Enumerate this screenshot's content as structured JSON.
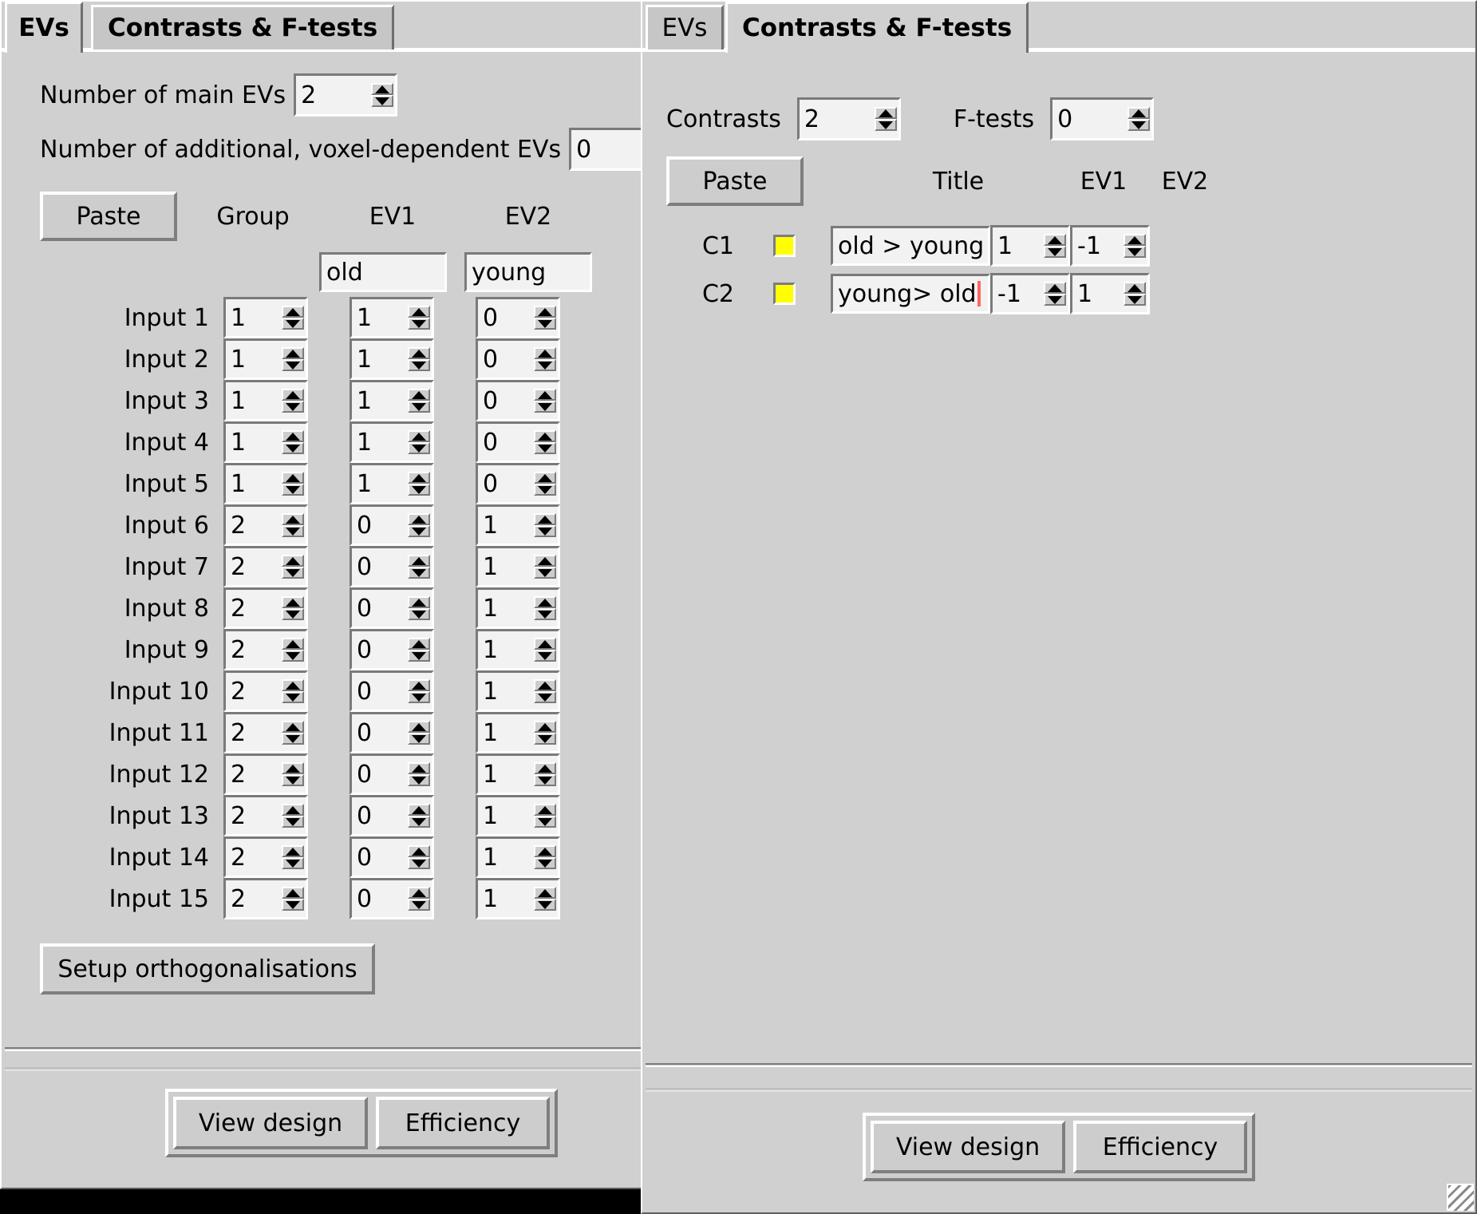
{
  "app": {
    "accent_yellow": "#ffff00",
    "bg": "#d0d0d0",
    "field_bg": "#f2f2f2",
    "caret_color": "#ff6666"
  },
  "evs_window": {
    "tabs": [
      {
        "id": "evs",
        "label": "EVs",
        "selected": true
      },
      {
        "id": "contrasts",
        "label": "Contrasts & F-tests",
        "selected": false
      }
    ],
    "num_main_evs": {
      "label": "Number of main EVs",
      "value": "2"
    },
    "num_additional_evs": {
      "label": "Number of additional, voxel-dependent EVs",
      "value": "0"
    },
    "paste_label": "Paste",
    "columns": {
      "group": "Group",
      "ev1": "EV1",
      "ev2": "EV2"
    },
    "ev_titles": {
      "ev1": "old",
      "ev2": "young"
    },
    "rows": [
      {
        "label": "Input 1",
        "group": "1",
        "ev1": "1",
        "ev2": "0"
      },
      {
        "label": "Input 2",
        "group": "1",
        "ev1": "1",
        "ev2": "0"
      },
      {
        "label": "Input 3",
        "group": "1",
        "ev1": "1",
        "ev2": "0"
      },
      {
        "label": "Input 4",
        "group": "1",
        "ev1": "1",
        "ev2": "0"
      },
      {
        "label": "Input 5",
        "group": "1",
        "ev1": "1",
        "ev2": "0"
      },
      {
        "label": "Input 6",
        "group": "2",
        "ev1": "0",
        "ev2": "1"
      },
      {
        "label": "Input 7",
        "group": "2",
        "ev1": "0",
        "ev2": "1"
      },
      {
        "label": "Input 8",
        "group": "2",
        "ev1": "0",
        "ev2": "1"
      },
      {
        "label": "Input 9",
        "group": "2",
        "ev1": "0",
        "ev2": "1"
      },
      {
        "label": "Input 10",
        "group": "2",
        "ev1": "0",
        "ev2": "1"
      },
      {
        "label": "Input 11",
        "group": "2",
        "ev1": "0",
        "ev2": "1"
      },
      {
        "label": "Input 12",
        "group": "2",
        "ev1": "0",
        "ev2": "1"
      },
      {
        "label": "Input 13",
        "group": "2",
        "ev1": "0",
        "ev2": "1"
      },
      {
        "label": "Input 14",
        "group": "2",
        "ev1": "0",
        "ev2": "1"
      },
      {
        "label": "Input 15",
        "group": "2",
        "ev1": "0",
        "ev2": "1"
      }
    ],
    "setup_orthogonalisations_label": "Setup orthogonalisations",
    "footer": {
      "view_design": "View design",
      "efficiency": "Efficiency"
    }
  },
  "contrasts_window": {
    "tabs": [
      {
        "id": "evs",
        "label": "EVs",
        "selected": false
      },
      {
        "id": "contrasts",
        "label": "Contrasts & F-tests",
        "selected": true
      }
    ],
    "contrasts_count": {
      "label": "Contrasts",
      "value": "2"
    },
    "ftests_count": {
      "label": "F-tests",
      "value": "0"
    },
    "paste_label": "Paste",
    "columns": {
      "title": "Title",
      "ev1": "EV1",
      "ev2": "EV2"
    },
    "rows": [
      {
        "label": "C1",
        "checked": true,
        "title": "old > young",
        "has_caret": false,
        "ev1": "1",
        "ev2": "-1"
      },
      {
        "label": "C2",
        "checked": true,
        "title": "young> old",
        "has_caret": true,
        "ev1": "-1",
        "ev2": "1"
      }
    ],
    "footer": {
      "view_design": "View design",
      "efficiency": "Efficiency"
    }
  }
}
